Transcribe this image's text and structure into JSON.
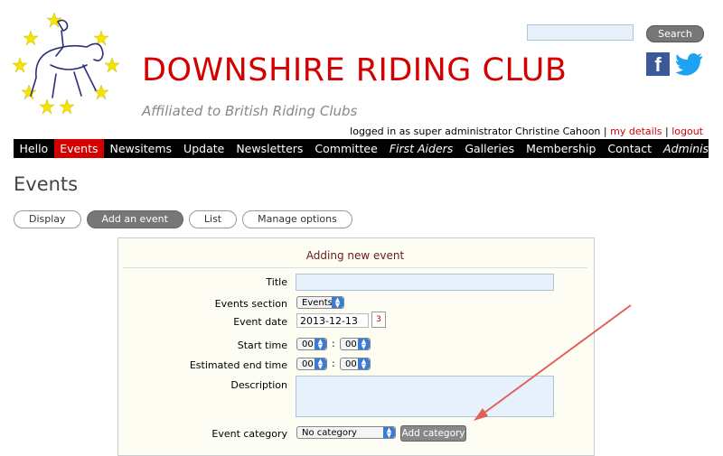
{
  "header": {
    "site_title": "DOWNSHIRE RIDING CLUB",
    "tagline": "Affiliated to British Riding Clubs",
    "search_button": "Search",
    "facebook_glyph": "f",
    "login_text": "logged in as super administrator Christine Cahoon |",
    "my_details": "my details",
    "separator": "|",
    "logout": "logout"
  },
  "nav": {
    "items": [
      {
        "label": "Hello"
      },
      {
        "label": "Events"
      },
      {
        "label": "Newsitems"
      },
      {
        "label": "Update"
      },
      {
        "label": "Newsletters"
      },
      {
        "label": "Committee"
      },
      {
        "label": "First Aiders"
      },
      {
        "label": "Galleries"
      },
      {
        "label": "Membership"
      },
      {
        "label": "Contact"
      },
      {
        "label": "Administration"
      }
    ]
  },
  "page": {
    "title": "Events",
    "tabs": [
      {
        "label": "Display"
      },
      {
        "label": "Add an event"
      },
      {
        "label": "List"
      },
      {
        "label": "Manage options"
      }
    ]
  },
  "form": {
    "heading": "Adding new event",
    "title_label": "Title",
    "section_label": "Events section",
    "section_value": "Events",
    "date_label": "Event date",
    "date_value": "2013-12-13",
    "calendar_glyph": "3",
    "start_label": "Start time",
    "start_hour": "00",
    "start_minute": "00",
    "end_label": "Estimated end time",
    "end_hour": "00",
    "end_minute": "00",
    "colon": ":",
    "description_label": "Description",
    "category_label": "Event category",
    "category_value": "No category",
    "add_category_button": "Add category"
  },
  "colors": {
    "accent": "#d40000",
    "nav_bg": "#000000",
    "annotation_arrow": "#e0605a"
  }
}
